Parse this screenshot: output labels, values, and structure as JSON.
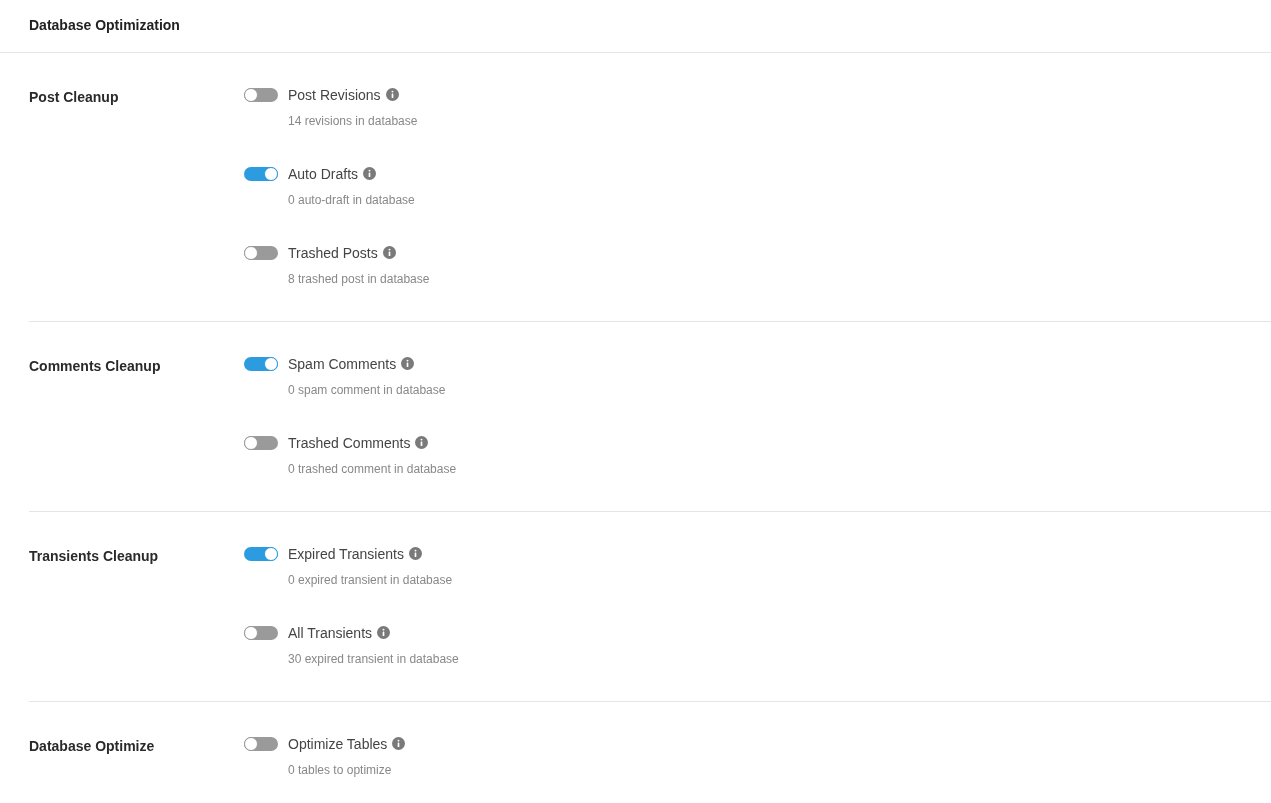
{
  "header": {
    "title": "Database Optimization"
  },
  "sections": [
    {
      "title": "Post Cleanup",
      "options": [
        {
          "label": "Post Revisions",
          "on": false,
          "description": "14 revisions in database"
        },
        {
          "label": "Auto Drafts",
          "on": true,
          "description": "0 auto-draft in database"
        },
        {
          "label": "Trashed Posts",
          "on": false,
          "description": "8 trashed post in database"
        }
      ]
    },
    {
      "title": "Comments Cleanup",
      "options": [
        {
          "label": "Spam Comments",
          "on": true,
          "description": "0 spam comment in database"
        },
        {
          "label": "Trashed Comments",
          "on": false,
          "description": "0 trashed comment in database"
        }
      ]
    },
    {
      "title": "Transients Cleanup",
      "options": [
        {
          "label": "Expired Transients",
          "on": true,
          "description": "0 expired transient in database"
        },
        {
          "label": "All Transients",
          "on": false,
          "description": "30 expired transient in database"
        }
      ]
    },
    {
      "title": "Database Optimize",
      "options": [
        {
          "label": "Optimize Tables",
          "on": false,
          "description": "0 tables to optimize"
        }
      ]
    }
  ]
}
